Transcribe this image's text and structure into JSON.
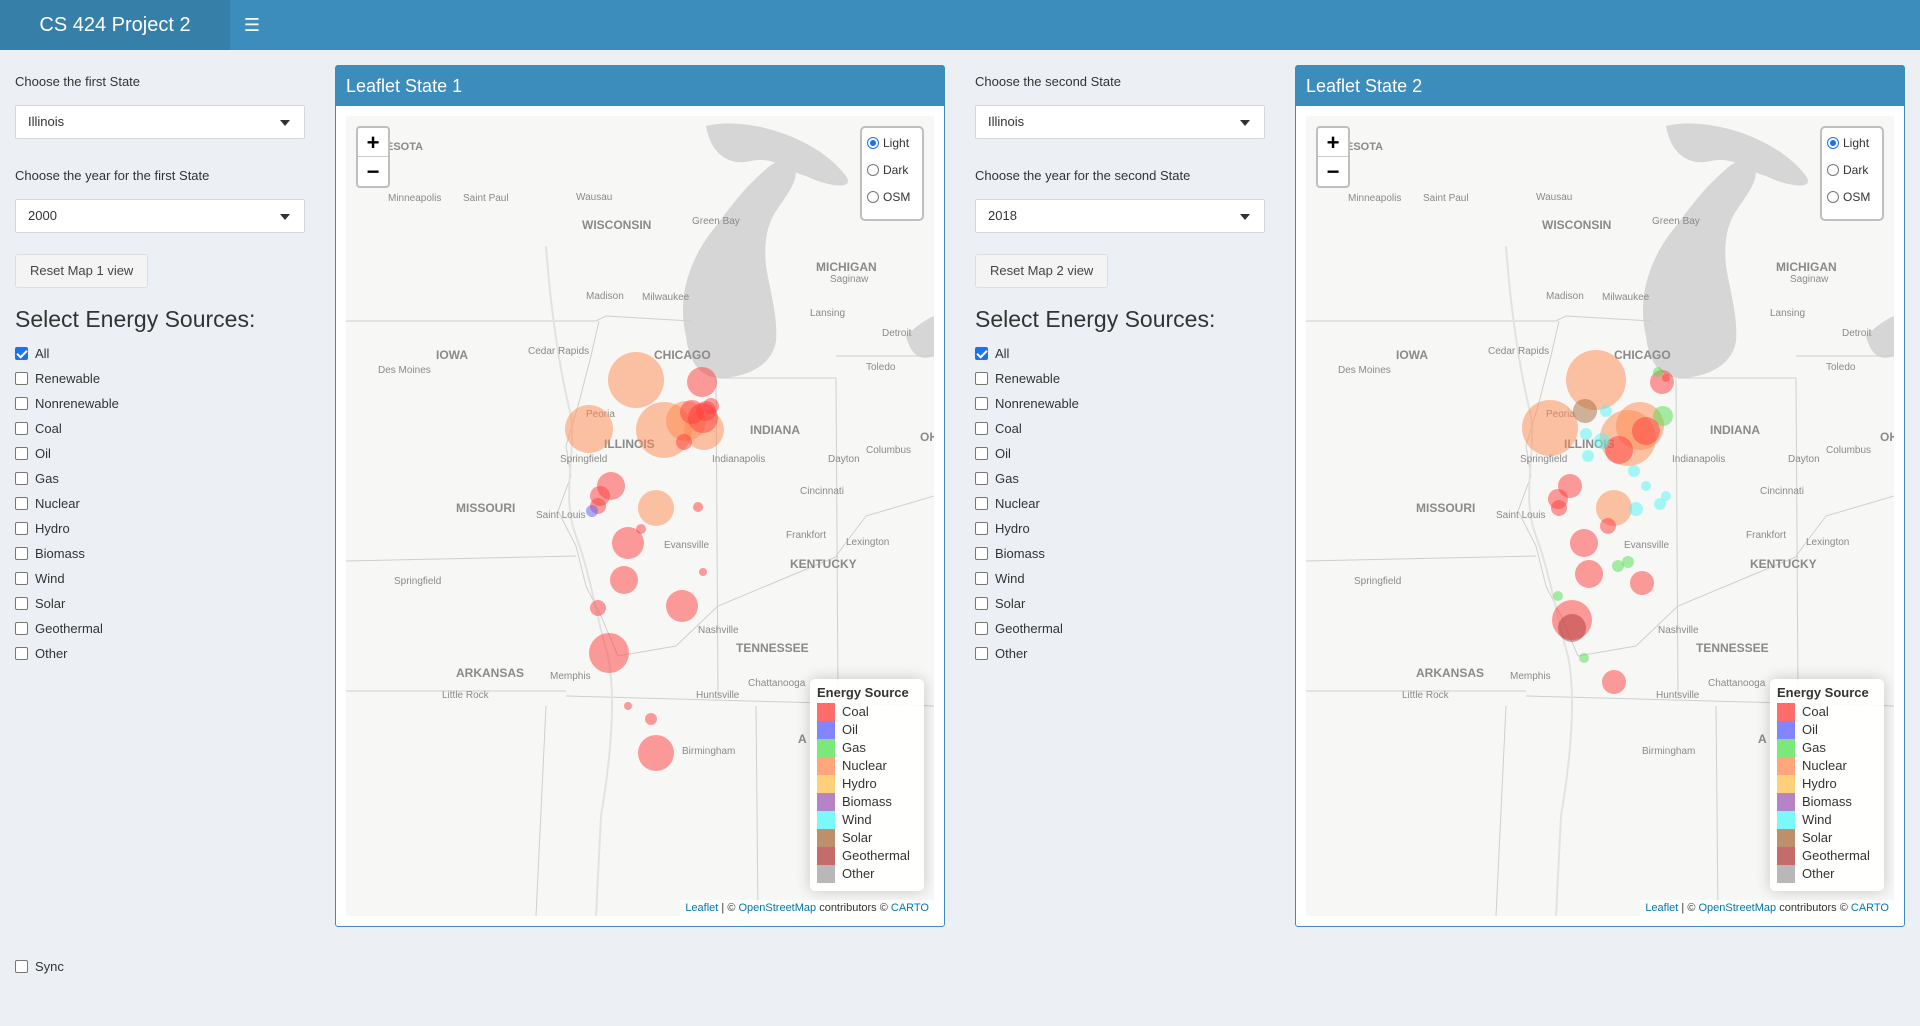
{
  "header": {
    "title": "CS 424 Project 2",
    "menu_icon": "hamburger-icon",
    "color": "#3c8dbc"
  },
  "left_controls": {
    "state_label": "Choose the first State",
    "state_value": "Illinois",
    "year_label": "Choose the year for the first State",
    "year_value": "2000",
    "reset_button": "Reset Map 1 view",
    "energy_title": "Select Energy Sources:",
    "sources": [
      {
        "label": "All",
        "checked": true
      },
      {
        "label": "Renewable",
        "checked": false
      },
      {
        "label": "Nonrenewable",
        "checked": false
      },
      {
        "label": "Coal",
        "checked": false
      },
      {
        "label": "Oil",
        "checked": false
      },
      {
        "label": "Gas",
        "checked": false
      },
      {
        "label": "Nuclear",
        "checked": false
      },
      {
        "label": "Hydro",
        "checked": false
      },
      {
        "label": "Biomass",
        "checked": false
      },
      {
        "label": "Wind",
        "checked": false
      },
      {
        "label": "Solar",
        "checked": false
      },
      {
        "label": "Geothermal",
        "checked": false
      },
      {
        "label": "Other",
        "checked": false
      }
    ],
    "sync_label": "Sync",
    "sync_checked": false
  },
  "right_controls": {
    "state_label": "Choose the second State",
    "state_value": "Illinois",
    "year_label": "Choose the year for the second State",
    "year_value": "2018",
    "reset_button": "Reset Map 2 view",
    "energy_title": "Select Energy Sources:",
    "sources": [
      {
        "label": "All",
        "checked": true
      },
      {
        "label": "Renewable",
        "checked": false
      },
      {
        "label": "Nonrenewable",
        "checked": false
      },
      {
        "label": "Coal",
        "checked": false
      },
      {
        "label": "Oil",
        "checked": false
      },
      {
        "label": "Gas",
        "checked": false
      },
      {
        "label": "Nuclear",
        "checked": false
      },
      {
        "label": "Hydro",
        "checked": false
      },
      {
        "label": "Biomass",
        "checked": false
      },
      {
        "label": "Wind",
        "checked": false
      },
      {
        "label": "Solar",
        "checked": false
      },
      {
        "label": "Geothermal",
        "checked": false
      },
      {
        "label": "Other",
        "checked": false
      }
    ]
  },
  "map1": {
    "title": "Leaflet State 1",
    "zoom_in": "+",
    "zoom_out": "−",
    "layers": [
      {
        "label": "Light",
        "selected": true
      },
      {
        "label": "Dark",
        "selected": false
      },
      {
        "label": "OSM",
        "selected": false
      }
    ],
    "legend_title": "Energy Source"
  },
  "map2": {
    "title": "Leaflet State 2",
    "zoom_in": "+",
    "zoom_out": "−",
    "layers": [
      {
        "label": "Light",
        "selected": true
      },
      {
        "label": "Dark",
        "selected": false
      },
      {
        "label": "OSM",
        "selected": false
      }
    ],
    "legend_title": "Energy Source"
  },
  "legend": [
    {
      "label": "Coal",
      "color": "#ff3b3b"
    },
    {
      "label": "Oil",
      "color": "#5b5bff"
    },
    {
      "label": "Gas",
      "color": "#4fe04f"
    },
    {
      "label": "Nuclear",
      "color": "#ff8a50"
    },
    {
      "label": "Hydro",
      "color": "#ffc04f"
    },
    {
      "label": "Biomass",
      "color": "#9b59b6"
    },
    {
      "label": "Wind",
      "color": "#4ff5f5"
    },
    {
      "label": "Solar",
      "color": "#a86a3c"
    },
    {
      "label": "Geothermal",
      "color": "#b03a3a"
    },
    {
      "label": "Other",
      "color": "#a0a0a0"
    }
  ],
  "attribution": {
    "leaflet": "Leaflet",
    "sep": " | © ",
    "osm": "OpenStreetMap",
    "contrib": " contributors © ",
    "carto": "CARTO"
  },
  "map_labels": {
    "minnesota": "ESOTA",
    "minneapolis": "Minneapolis",
    "saint_paul": "Saint Paul",
    "wausau": "Wausau",
    "wisconsin": "WISCONSIN",
    "green_bay": "Green Bay",
    "michigan": "MICHIGAN",
    "saginaw": "Saginaw",
    "madison": "Madison",
    "milwaukee": "Milwaukee",
    "lansing": "Lansing",
    "detroit": "Detroit",
    "iowa": "IOWA",
    "cedar_rapids": "Cedar Rapids",
    "chicago": "CHICAGO",
    "des_moines": "Des Moines",
    "toledo": "Toledo",
    "peoria": "Peoria",
    "indiana": "INDIANA",
    "oh": "OH",
    "illinois": "ILLINOIS",
    "springfield_il": "Springfield",
    "indianapolis": "Indianapolis",
    "dayton": "Dayton",
    "columbus": "Columbus",
    "cincinnati": "Cincinnati",
    "missouri": "MISSOURI",
    "saint_louis": "Saint Louis",
    "frankfort": "Frankfort",
    "evansville": "Evansville",
    "lexington": "Lexington",
    "kentucky": "KENTUCKY",
    "springfield_mo": "Springfield",
    "nashville": "Nashville",
    "tennessee": "TENNESSEE",
    "arkansas": "ARKANSAS",
    "memphis": "Memphis",
    "chattanooga": "Chattanooga",
    "little_rock": "Little Rock",
    "huntsville": "Huntsville",
    "birmingham": "Birmingham",
    "al": "A"
  }
}
